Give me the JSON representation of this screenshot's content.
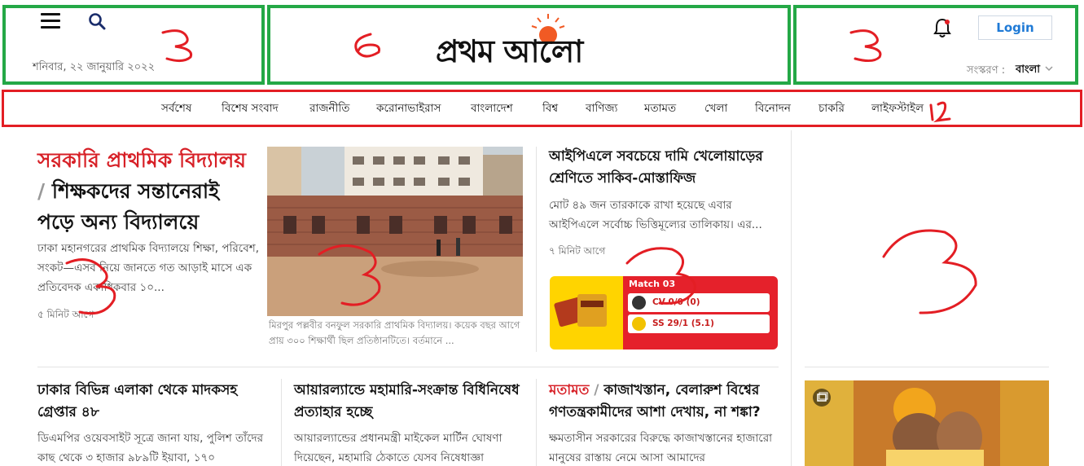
{
  "header": {
    "date": "শনিবার, ২২ জানুয়ারি ২০২২",
    "logo_text": "প্রথম আলো",
    "login": "Login",
    "edition_label": "সংস্করণ :",
    "edition_value": "বাংলা"
  },
  "nav": [
    "সর্বশেষ",
    "বিশেষ সংবাদ",
    "রাজনীতি",
    "করোনাভাইরাস",
    "বাংলাদেশ",
    "বিশ্ব",
    "বাণিজ্য",
    "মতামত",
    "খেলা",
    "বিনোদন",
    "চাকরি",
    "লাইফস্টাইল"
  ],
  "lead": {
    "kicker": "সরকারি প্রাথমিক বিদ্যালয়",
    "sep": " /",
    "title": "শিক্ষকদের সন্তানেরাই পড়ে অন্য বিদ্যালয়ে",
    "summary": "ঢাকা মহানগরের প্রাথমিক বিদ্যালয়ে শিক্ষা, পরিবেশ, সংকট—এসব নিয়ে জানতে গত আড়াই মাসে এক প্রতিবেদক একাধিকবার ১০...",
    "time": "৫ মিনিট আগে"
  },
  "photo_caption": "মিরপুর পল্লবীর বনফুল সরকারি প্রাথমিক বিদ্যালয়। কয়েক বছর আগে প্রায় ৩০০ শিক্ষার্থী ছিল প্রতিষ্ঠানটিতে। বর্তমানে ...",
  "story2": {
    "title": "আইপিএলে সবচেয়ে দামি খেলোয়াড়ের শ্রেণিতে সাকিব-মোস্তাফিজ",
    "summary": "মোট ৪৯ জন তারকাকে রাখা হয়েছে এবার আইপিএলে সর্বোচ্চ ভিত্তিমূল্যের তালিকায়। এর...",
    "time": "৭ মিনিট আগে"
  },
  "widget": {
    "match": "Match 03",
    "team1": "CV 0/0 (0)",
    "team2": "SS 29/1 (5.1)"
  },
  "row2": [
    {
      "title": "ঢাকার বিভিন্ন এলাকা থেকে মাদকসহ গ্রেপ্তার ৪৮",
      "summary": "ডিএমপির ওয়েবসাইট সূত্রে জানা যায়, পুলিশ তাঁদের কাছ থেকে ৩ হাজার ৯৮৯টি ইয়াবা, ১৭০"
    },
    {
      "title": "আয়ারল্যান্ডে মহামারি-সংক্রান্ত বিধিনিষেধ প্রত্যাহার হচ্ছে",
      "summary": "আয়ারল্যান্ডের প্রধানমন্ত্রী মাইকেল মার্টিন ঘোষণা দিয়েছেন, মহামারি ঠেকাতে যেসব নিষেধাজ্ঞা"
    },
    {
      "kicker": "মতামত",
      "sep": " / ",
      "title": "কাজাখস্তান, বেলারুশ বিশ্বের গণতন্ত্রকামীদের আশা দেখায়, না শঙ্কা?",
      "summary": "ক্ষমতাসীন সরকারের বিরুদ্ধে কাজাখস্তানের হাজারো মানুষের রাস্তায় নেমে আসা আমাদের"
    }
  ],
  "annotations": {
    "hdr_left": "3",
    "hdr_center": "6",
    "hdr_right": "3",
    "nav": "12",
    "lead": "3",
    "photo": "3",
    "story2": "3",
    "right": "3"
  },
  "colors": {
    "green_box": "#24a846",
    "red_box": "#e31e24",
    "accent_red": "#d71f26",
    "login_blue": "#1f7ad6"
  }
}
